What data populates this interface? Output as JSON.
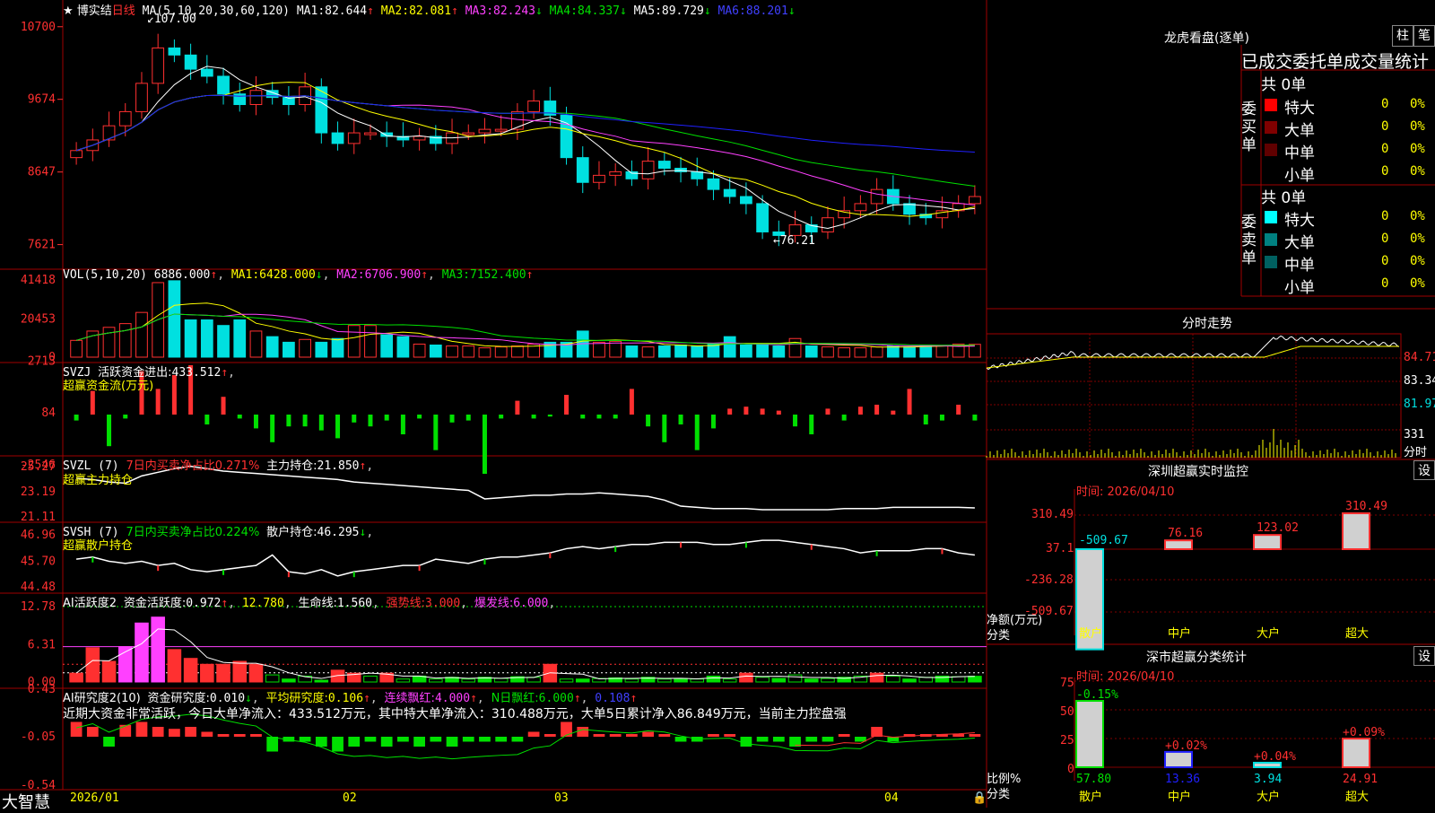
{
  "colors": {
    "up": "#ff3030",
    "down": "#00e0e0",
    "frame": "#a00000",
    "grid": "#800000",
    "yellow": "#ffff00",
    "magenta": "#ff40ff",
    "green": "#00e000",
    "blue": "#2020ff"
  },
  "main": {
    "stock_name": "★ 博实结",
    "period": "日线",
    "ma_label": "MA(5,10,20,30,60,120)",
    "ma": [
      {
        "name": "MA1:",
        "value": "82.644",
        "arrow": "↑"
      },
      {
        "name": "MA2:",
        "value": "82.081",
        "arrow": "↑"
      },
      {
        "name": "MA3:",
        "value": "82.243",
        "arrow": "↓"
      },
      {
        "name": "MA4:",
        "value": "84.337",
        "arrow": "↓"
      },
      {
        "name": "MA5:",
        "value": "89.729",
        "arrow": "↓"
      },
      {
        "name": "MA6:",
        "value": "88.201",
        "arrow": "↓"
      }
    ],
    "y_ticks": [
      "10700",
      "9674",
      "8647",
      "7621"
    ],
    "high_mark": "107.00",
    "low_mark": "76.21",
    "closes": [
      89.5,
      91,
      93,
      95,
      99,
      104,
      103,
      101,
      100,
      97.5,
      96,
      98,
      97,
      96,
      98.5,
      92,
      90.5,
      92,
      92,
      91.5,
      91,
      91.5,
      90.5,
      92,
      92,
      92.5,
      92.5,
      95,
      96.5,
      94.5,
      88.5,
      85,
      86,
      86.5,
      85.5,
      88,
      87,
      86.5,
      85.5,
      84,
      83,
      82,
      78,
      77.5,
      79,
      78,
      80,
      81,
      82,
      84,
      82,
      80.5,
      80,
      81,
      82,
      83
    ]
  },
  "vol": {
    "label": "VOL(5,10,20)",
    "value": "6886.000",
    "arrow": "↑",
    "ma": [
      {
        "name": "MA1:",
        "value": "6428.000",
        "arrow": "↓"
      },
      {
        "name": "MA2:",
        "value": "6706.900",
        "arrow": "↑"
      },
      {
        "name": "MA3:",
        "value": "7152.400",
        "arrow": "↑"
      }
    ],
    "y_ticks": [
      "41418",
      "20453",
      "0"
    ],
    "values": [
      9000,
      14000,
      16000,
      18000,
      24000,
      40000,
      41000,
      20000,
      20000,
      17000,
      20000,
      14000,
      11000,
      8000,
      9500,
      8000,
      10000,
      17000,
      17000,
      12000,
      11000,
      7000,
      6500,
      6000,
      6000,
      5000,
      5500,
      6000,
      7000,
      8000,
      8000,
      14000,
      8000,
      8500,
      6000,
      5500,
      6000,
      6500,
      6000,
      7000,
      11000,
      6500,
      6500,
      6000,
      10000,
      6000,
      5500,
      5000,
      5000,
      5500,
      6000,
      5500,
      6500,
      6000,
      7000,
      6886
    ]
  },
  "svzj": {
    "label": "SVZJ",
    "desc": "活跃资金进出:",
    "value": "433.512",
    "arrow": "↑",
    "subtitle": "超赢资金流(万元)",
    "y_ticks": [
      "2713",
      "84",
      "-2546"
    ],
    "values": [
      -300,
      1200,
      -1600,
      -200,
      2200,
      1300,
      2000,
      2500,
      -500,
      900,
      -200,
      -700,
      -1400,
      -600,
      -600,
      -800,
      -1200,
      -400,
      -600,
      -300,
      -1000,
      -200,
      -1800,
      -400,
      -300,
      -3000,
      -200,
      700,
      -200,
      -100,
      1000,
      -200,
      -200,
      -200,
      1300,
      -600,
      -1400,
      -500,
      -1800,
      -700,
      300,
      400,
      300,
      200,
      -600,
      -1000,
      300,
      -300,
      400,
      500,
      200,
      1300,
      -500,
      -300,
      500,
      -300
    ]
  },
  "svzl": {
    "label": "SVZL (7)",
    "desc": "7日内买卖净占比0.271%",
    "desc2": "主力持仓:",
    "value": "21.850",
    "arrow": "↑",
    "subtitle": "超赢主力持仓",
    "y_ticks": [
      "25.27",
      "23.19",
      "21.11"
    ],
    "values": [
      24.3,
      24.2,
      24.0,
      23.9,
      24.5,
      24.8,
      25.1,
      25.3,
      25.1,
      24.9,
      24.8,
      24.7,
      24.6,
      24.5,
      24.4,
      24.3,
      24.2,
      24.0,
      23.9,
      23.8,
      23.7,
      23.6,
      23.5,
      23.4,
      23.3,
      22.6,
      22.7,
      22.8,
      22.9,
      22.9,
      23.0,
      23.0,
      23.1,
      23.0,
      22.9,
      22.8,
      22.5,
      22.0,
      21.9,
      21.8,
      21.8,
      21.8,
      21.7,
      21.7,
      21.7,
      21.7,
      21.7,
      21.8,
      21.8,
      21.8,
      21.9,
      21.9,
      21.9,
      21.9,
      21.9,
      21.85
    ]
  },
  "svsh": {
    "label": "SVSH (7)",
    "desc": "7日内买卖净占比0.224%",
    "desc2": "散户持仓:",
    "value": "46.295",
    "arrow": "↓",
    "subtitle": "超赢散户持仓",
    "y_ticks": [
      "46.96",
      "45.70",
      "44.48"
    ],
    "values": [
      45.8,
      45.9,
      45.7,
      45.6,
      45.7,
      45.5,
      45.6,
      45.3,
      45.2,
      45.3,
      45.4,
      45.5,
      46.0,
      45.2,
      45.1,
      45.3,
      45.0,
      45.2,
      45.3,
      45.4,
      45.5,
      45.5,
      45.8,
      45.7,
      45.6,
      45.8,
      45.9,
      45.9,
      46.0,
      46.1,
      46.3,
      46.4,
      46.3,
      46.4,
      46.5,
      46.5,
      46.6,
      46.6,
      46.6,
      46.5,
      46.5,
      46.6,
      46.7,
      46.7,
      46.6,
      46.5,
      46.4,
      46.3,
      46.1,
      46.2,
      46.2,
      46.2,
      46.3,
      46.3,
      46.1,
      46.0
    ]
  },
  "ai_active": {
    "label": "AI活跃度2",
    "desc": "资金活跃度:",
    "value": "0.972",
    "arrow": "↑",
    "v2": "12.780",
    "life_label": "生命线:",
    "life": "1.560",
    "strong_label": "强势线:",
    "strong": "3.000",
    "burst_label": "爆发线:",
    "burst": "6.000",
    "y_ticks": [
      "12.78",
      "6.31",
      "0.00"
    ],
    "values": [
      1.5,
      5.8,
      3.5,
      6.0,
      10,
      11,
      5.5,
      4,
      3,
      3,
      3.5,
      3,
      1.2,
      0.5,
      1,
      0.3,
      2,
      1.5,
      1,
      1.5,
      0.5,
      1,
      0.5,
      0.8,
      0.5,
      0.8,
      0.6,
      0.9,
      0.8,
      3,
      0.5,
      0.5,
      0.6,
      0.7,
      0.5,
      0.8,
      0.5,
      0.6,
      0.5,
      1,
      0.5,
      1.5,
      0.8,
      0.6,
      1.2,
      0.5,
      0.6,
      0.8,
      1,
      1.5,
      1,
      0.5,
      0.8,
      1,
      0.9,
      0.97
    ]
  },
  "ai_research": {
    "label": "AI研究度2(10)",
    "desc": "资金研究度:",
    "value": "0.010",
    "arrow": "↓",
    "avg_label": "平均研究度:",
    "avg": "0.106",
    "avg_arrow": "↑",
    "red_label": "连续飘红:",
    "red": "4.000",
    "red_arrow": "↑",
    "n_label": "N日飘红:",
    "n": "6.000",
    "n_arrow": "↑",
    "tail": "0.108",
    "tail_arrow": "↑",
    "comment": "近期大资金非常活跃，今日大单净流入：433.512万元，其中特大单净流入：310.488万元，大单5日累计净入86.849万元，当前主力控盘强",
    "y_ticks": [
      "0.43",
      "-0.05",
      "-0.54"
    ],
    "values": [
      0.15,
      0.1,
      -0.1,
      0.12,
      0.15,
      0.1,
      0.08,
      0.1,
      0.05,
      0,
      0,
      0,
      -0.15,
      -0.05,
      -0.05,
      -0.1,
      -0.15,
      -0.1,
      -0.05,
      -0.1,
      -0.05,
      -0.1,
      -0.05,
      -0.1,
      -0.05,
      -0.05,
      -0.05,
      -0.05,
      0.05,
      0,
      0.15,
      0.1,
      0,
      0,
      0,
      0.05,
      0,
      -0.05,
      -0.05,
      0,
      0,
      -0.1,
      -0.05,
      -0.05,
      -0.1,
      -0.05,
      -0.05,
      0,
      -0.05,
      0.1,
      -0.05,
      0,
      0,
      0,
      0,
      0.01
    ]
  },
  "x_axis": [
    "2026/01",
    "02",
    "03",
    "04"
  ],
  "footer_logo": "大智慧",
  "dragon": {
    "title": "龙虎看盘(逐单)",
    "tabs": [
      "柱",
      "笔"
    ],
    "header": "已成交委托单成交量统计",
    "buy": {
      "side": "委买单",
      "total": "共 0单",
      "rows": [
        {
          "n": "特大",
          "v": "0",
          "p": "0%"
        },
        {
          "n": "大单",
          "v": "0",
          "p": "0%"
        },
        {
          "n": "中单",
          "v": "0",
          "p": "0%"
        },
        {
          "n": "小单",
          "v": "0",
          "p": "0%"
        }
      ]
    },
    "sell": {
      "side": "委卖单",
      "total": "共 0单",
      "rows": [
        {
          "n": "特大",
          "v": "0",
          "p": "0%"
        },
        {
          "n": "大单",
          "v": "0",
          "p": "0%"
        },
        {
          "n": "中单",
          "v": "0",
          "p": "0%"
        },
        {
          "n": "小单",
          "v": "0",
          "p": "0%"
        }
      ]
    }
  },
  "intraday": {
    "title": "分时走势",
    "y_ticks": [
      "84.71",
      "83.34",
      "81.97",
      "331",
      "分时"
    ]
  },
  "sz_monitor": {
    "title": "深圳超赢实时监控",
    "set": "设",
    "date": "时间: 2026/04/10",
    "y_ticks": [
      "310.49",
      "37.1",
      "-236.28",
      "-509.67"
    ],
    "axis_label1": "净额(万元)",
    "axis_label2": "分类",
    "cats": [
      "散户",
      "中户",
      "大户",
      "超大"
    ],
    "values": [
      -509.67,
      76.16,
      123.02,
      310.49
    ],
    "labels": [
      "-509.67",
      "76.16",
      "123.02",
      "310.49"
    ]
  },
  "sz_class": {
    "title": "深市超赢分类统计",
    "set": "设",
    "date": "时间: 2026/04/10",
    "y_ticks": [
      "75",
      "50",
      "25",
      "0"
    ],
    "axis_label1": "比例%",
    "axis_label2": "分类",
    "cats": [
      "散户",
      "中户",
      "大户",
      "超大"
    ],
    "values": [
      57.8,
      13.36,
      3.94,
      24.91
    ],
    "bottom": [
      "57.80",
      "13.36",
      "3.94",
      "24.91"
    ],
    "changes": [
      "-0.15%",
      "+0.02%",
      "+0.04%",
      "+0.09%"
    ]
  }
}
